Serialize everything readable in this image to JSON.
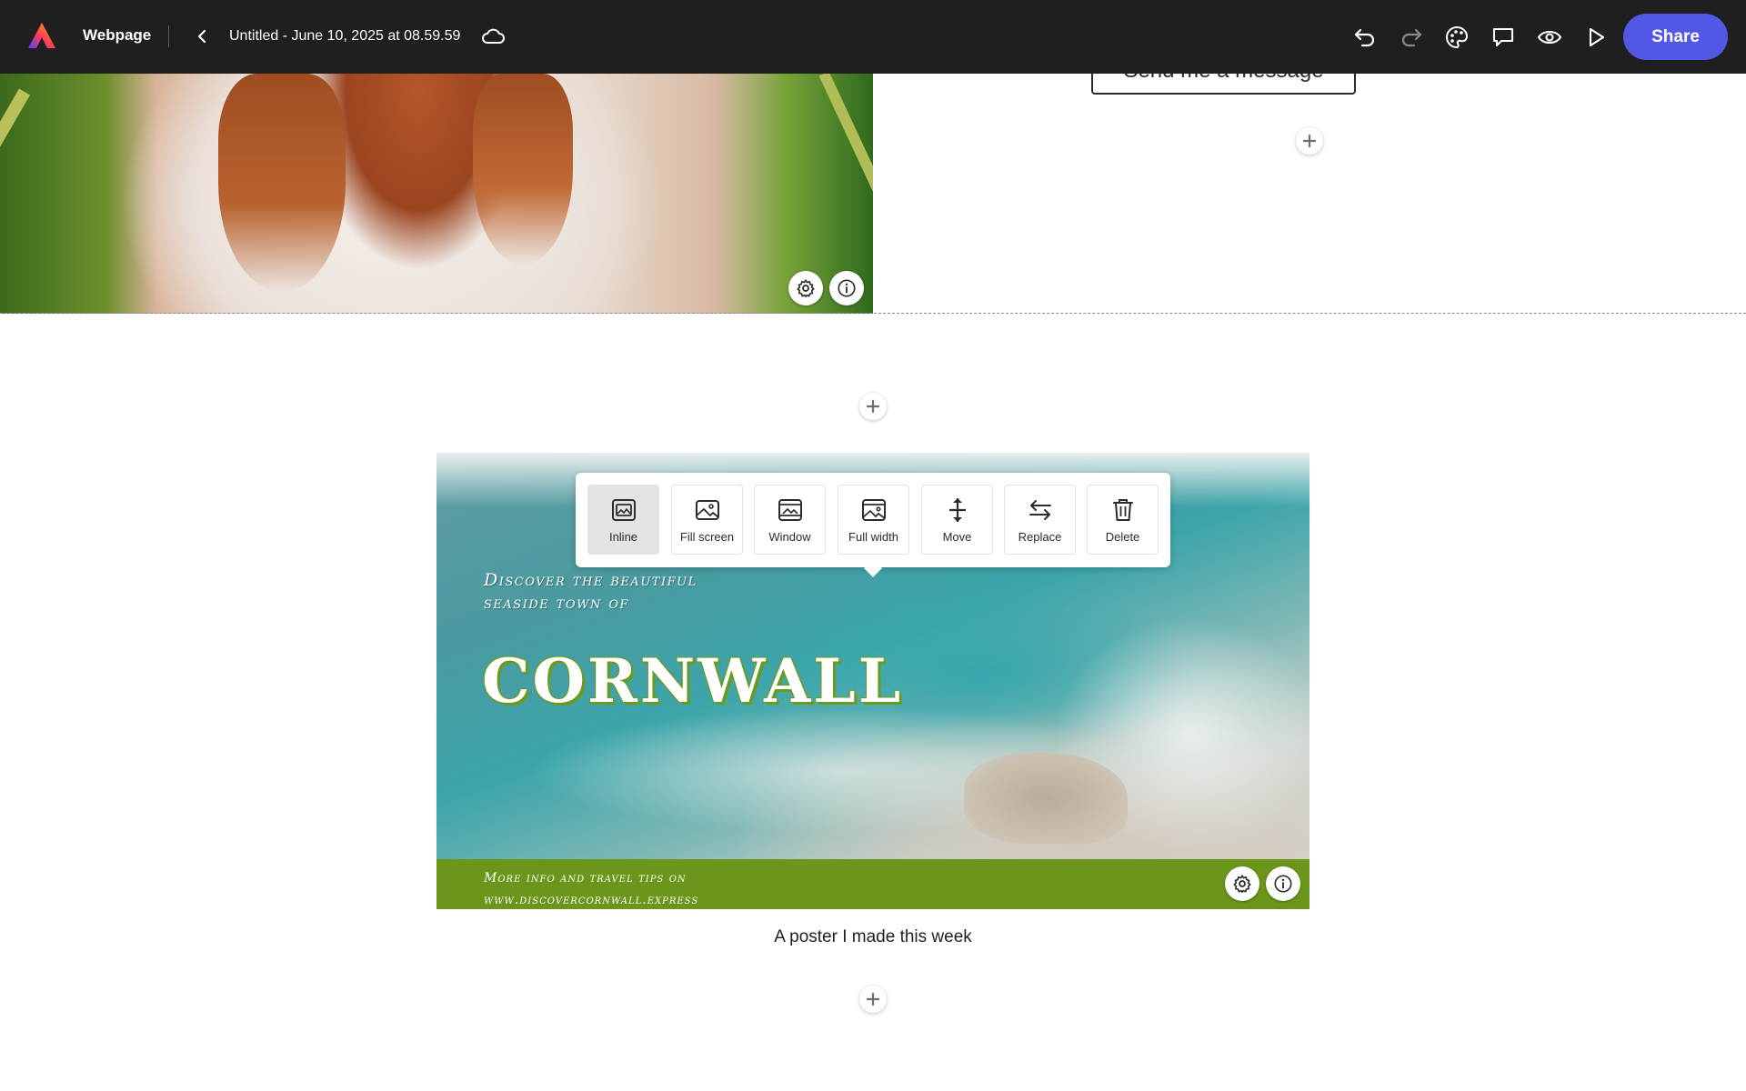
{
  "topbar": {
    "app_name": "Webpage",
    "doc_title": "Untitled - June 10, 2025 at 08.59.59",
    "share_label": "Share"
  },
  "content": {
    "message_button_label": "Send me a message",
    "poster": {
      "subtitle_line1": "Discover the beautiful",
      "subtitle_line2": "seaside town of",
      "title": "CORNWALL",
      "footer_line1": "More info and travel tips on",
      "footer_line2": "www.discovercornwall.express"
    },
    "caption": "A poster I made this week"
  },
  "image_toolbar": {
    "items": [
      {
        "label": "Inline",
        "icon": "inline-image-icon",
        "active": true
      },
      {
        "label": "Fill screen",
        "icon": "fill-screen-icon"
      },
      {
        "label": "Window",
        "icon": "window-icon"
      },
      {
        "label": "Full width",
        "icon": "full-width-icon"
      },
      {
        "label": "Move",
        "icon": "move-icon"
      },
      {
        "label": "Replace",
        "icon": "replace-icon"
      },
      {
        "label": "Delete",
        "icon": "trash-icon"
      }
    ]
  },
  "colors": {
    "topbar_bg": "#1f1f1f",
    "share_button": "#5258e4",
    "poster_green": "#6c961b"
  }
}
